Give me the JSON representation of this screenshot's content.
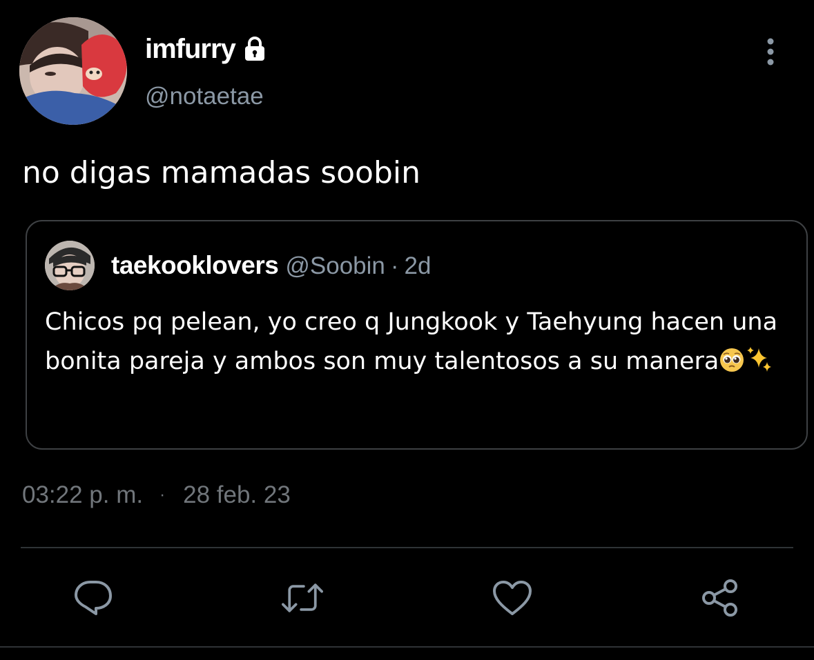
{
  "author": {
    "display_name": "imfurry",
    "handle": "@notaetae",
    "protected_icon": "lock-icon"
  },
  "tweet": {
    "text": "no digas mamadas soobin",
    "time": "03:22 p. m.",
    "separator": "·",
    "date": "28 feb. 23"
  },
  "quote": {
    "display_name": "taekooklovers",
    "handle": "@Soobin",
    "separator": "·",
    "relative_time": "2d",
    "text": "Chicos pq pelean, yo creo q Jungkook y Taehyung hacen una bonita pareja y ambos son muy talentosos a su manera",
    "emojis": [
      "pleading-face-emoji",
      "sparkles-emoji"
    ]
  },
  "actions": [
    "reply-icon",
    "retweet-icon",
    "like-icon",
    "share-icon"
  ],
  "menu_icon": "more-vertical-icon",
  "colors": {
    "background": "#000000",
    "primary_text": "#ffffff",
    "secondary_text": "#8b98a5",
    "border": "#3e4144",
    "icon": "#8b98a5"
  }
}
